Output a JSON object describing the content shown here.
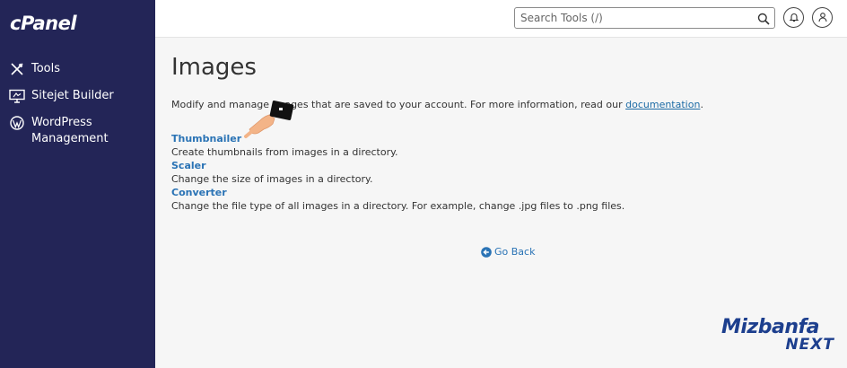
{
  "sidebar": {
    "logo": "cPanel",
    "items": [
      {
        "label": "Tools",
        "icon": "tools-icon"
      },
      {
        "label": "Sitejet Builder",
        "icon": "sitejet-monitor-icon"
      },
      {
        "label": "WordPress Management",
        "icon": "wordpress-icon"
      }
    ]
  },
  "header": {
    "search_placeholder": "Search Tools (/)",
    "icons": [
      "search-icon",
      "bell-icon",
      "user-icon"
    ]
  },
  "main": {
    "title": "Images",
    "intro_before": "Modify and manage images that are saved to your account. For more information, read our ",
    "intro_link": "documentation",
    "intro_after": ".",
    "tools": [
      {
        "label": "Thumbnailer",
        "description": "Create thumbnails from images in a directory."
      },
      {
        "label": "Scaler",
        "description": "Change the size of images in a directory."
      },
      {
        "label": "Converter",
        "description": "Change the file type of all images in a directory. For example, change .jpg files to .png files."
      }
    ],
    "go_back": "Go Back"
  },
  "watermark": {
    "line1": "Mizbanfa",
    "line2": "NEXT"
  },
  "colors": {
    "sidebar_bg": "#232557",
    "link": "#2a73b5",
    "page_bg": "#f6f6f6",
    "brand": "#1d3f8e"
  }
}
